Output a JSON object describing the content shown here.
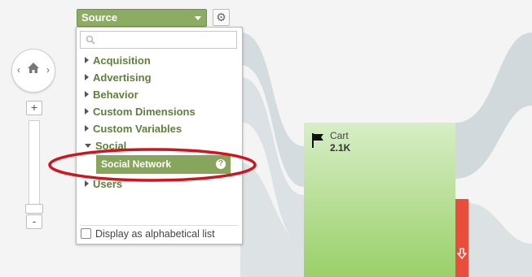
{
  "source_select": {
    "label": "Source"
  },
  "search": {
    "placeholder": "",
    "value": ""
  },
  "dimension_categories": [
    {
      "label": "Acquisition",
      "expanded": false
    },
    {
      "label": "Advertising",
      "expanded": false
    },
    {
      "label": "Behavior",
      "expanded": false
    },
    {
      "label": "Custom Dimensions",
      "expanded": false
    },
    {
      "label": "Custom Variables",
      "expanded": false
    },
    {
      "label": "Social",
      "expanded": true
    },
    {
      "label": "Users",
      "expanded": false
    }
  ],
  "selected_dimension": {
    "label": "Social Network",
    "help": "?"
  },
  "alphabetical_option": {
    "label": "Display as alphabetical list",
    "checked": false
  },
  "zoom": {
    "in": "+",
    "out": "-"
  },
  "cart_node": {
    "label": "Cart",
    "value": "2.1K"
  },
  "colors": {
    "accent_green": "#8cac64",
    "node_green": "#9ad06a",
    "dropoff_red": "#e94d3b",
    "highlight_circle": "#d0141b"
  }
}
